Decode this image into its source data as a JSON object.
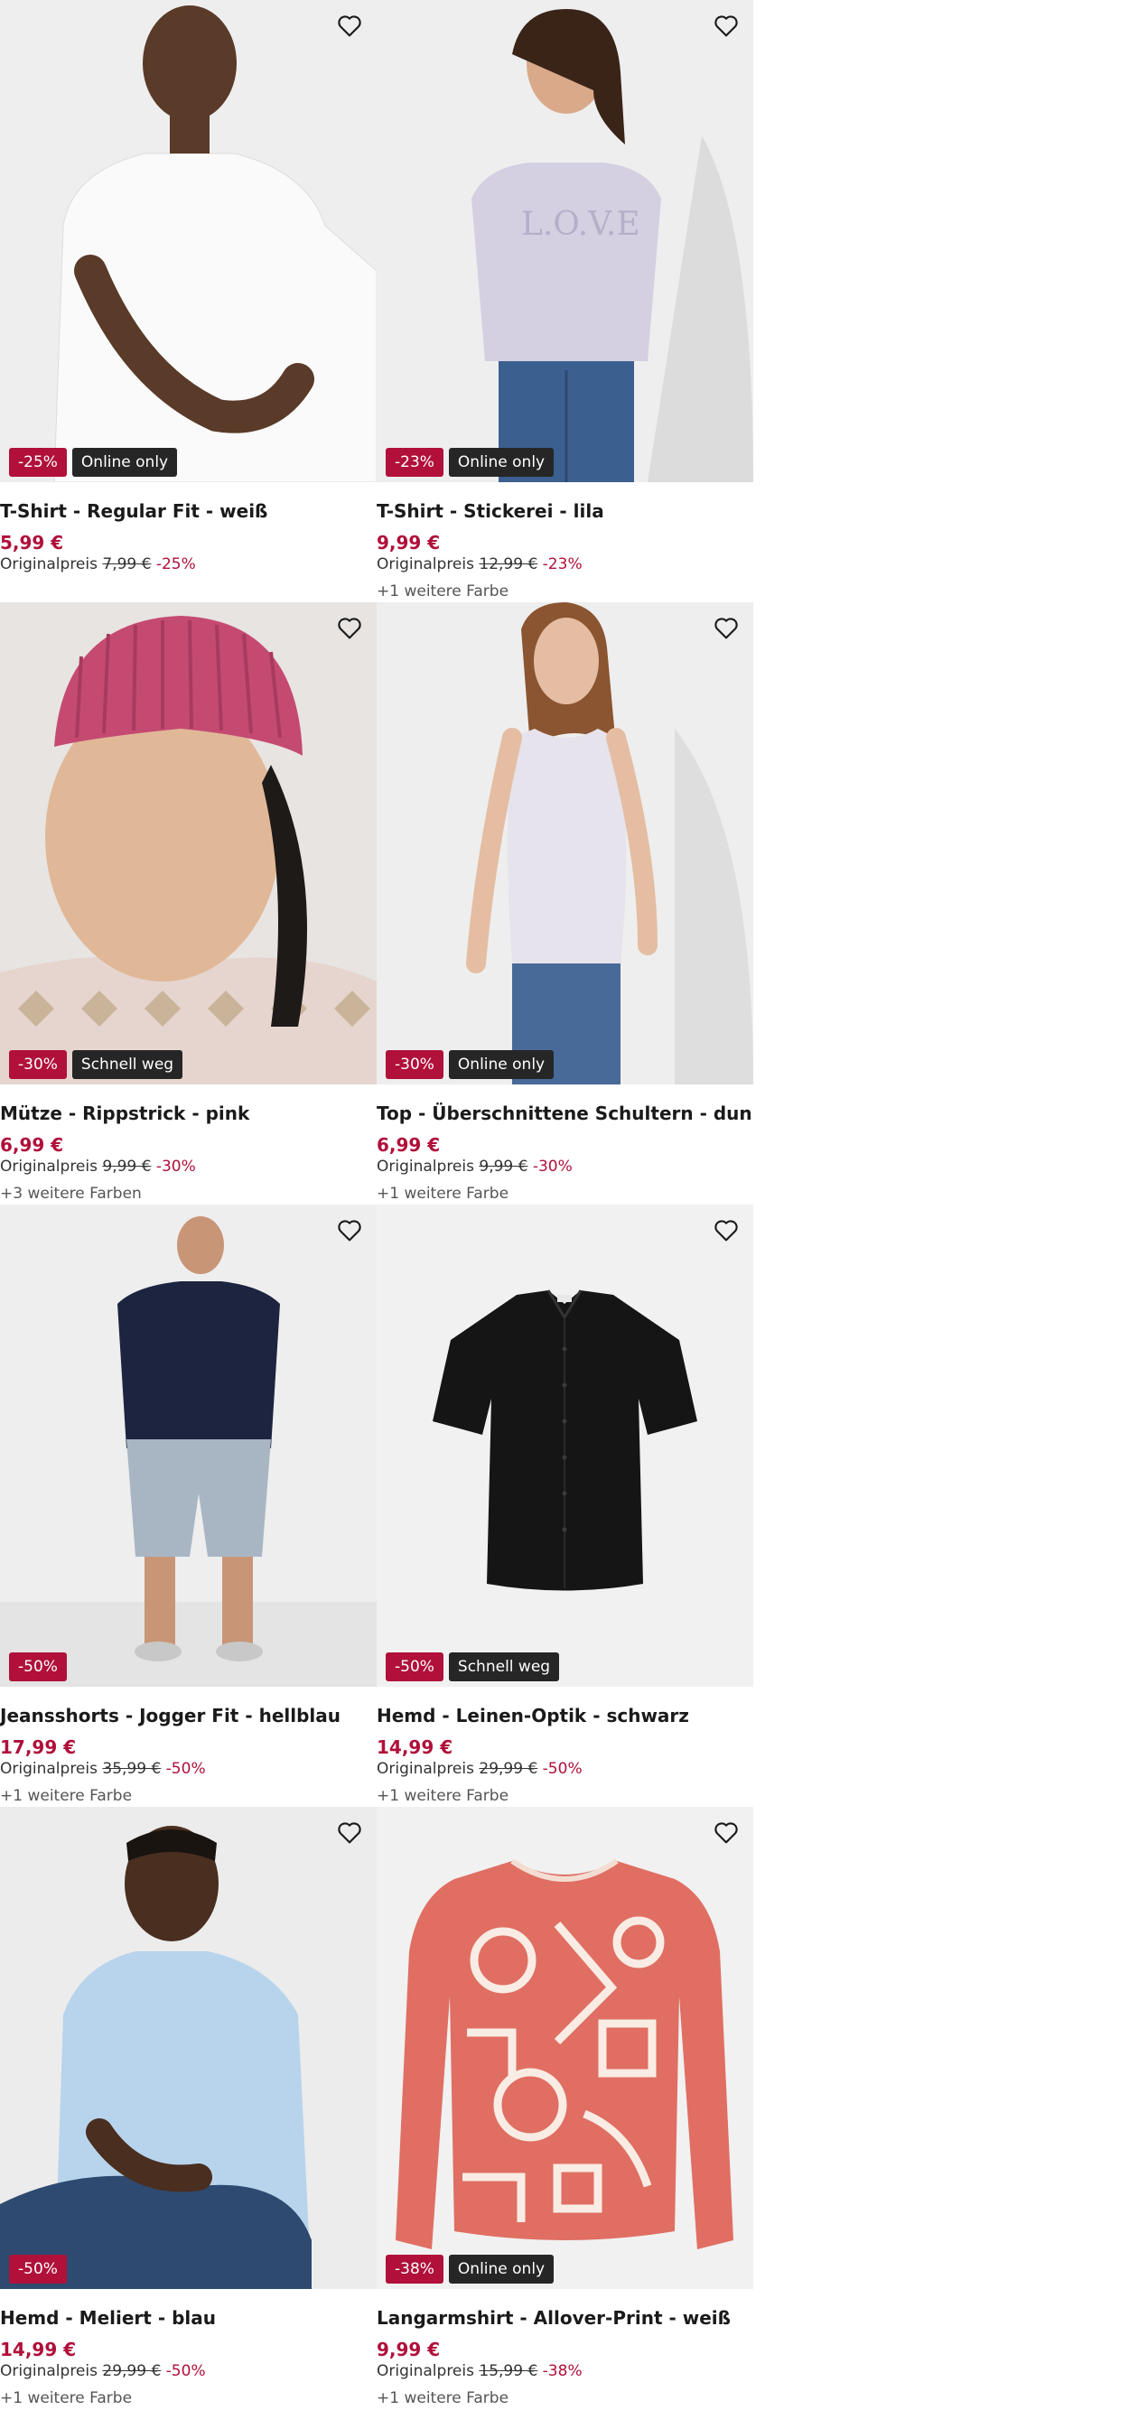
{
  "colors": {
    "sale": "#b0103a",
    "label_badge": "#262626",
    "image_background": "#eeeeee"
  },
  "icons": {
    "wishlist": "heart-outline-icon"
  },
  "products": [
    {
      "discount_badge": "-25%",
      "label_badge": "Online only",
      "title": "T-Shirt - Regular Fit - weiß",
      "price": "5,99 €",
      "original_label": "Originalpreis",
      "original_price": "7,99 €",
      "discount": "-25%",
      "more_colors": ""
    },
    {
      "discount_badge": "-23%",
      "label_badge": "Online only",
      "title": "T-Shirt - Stickerei - lila",
      "price": "9,99 €",
      "original_label": "Originalpreis",
      "original_price": "12,99 €",
      "discount": "-23%",
      "more_colors": "+1 weitere Farbe"
    },
    {
      "discount_badge": "-30%",
      "label_badge": "Schnell weg",
      "title": "Mütze - Rippstrick - pink",
      "price": "6,99 €",
      "original_label": "Originalpreis",
      "original_price": "9,99 €",
      "discount": "-30%",
      "more_colors": "+3 weitere Farben"
    },
    {
      "discount_badge": "-30%",
      "label_badge": "Online only",
      "title": "Top - Überschnittene Schultern - dunkellila",
      "price": "6,99 €",
      "original_label": "Originalpreis",
      "original_price": "9,99 €",
      "discount": "-30%",
      "more_colors": "+1 weitere Farbe"
    },
    {
      "discount_badge": "-50%",
      "label_badge": "",
      "title": "Jeansshorts - Jogger Fit - hellblau",
      "price": "17,99 €",
      "original_label": "Originalpreis",
      "original_price": "35,99 €",
      "discount": "-50%",
      "more_colors": "+1 weitere Farbe"
    },
    {
      "discount_badge": "-50%",
      "label_badge": "Schnell weg",
      "title": "Hemd - Leinen-Optik - schwarz",
      "price": "14,99 €",
      "original_label": "Originalpreis",
      "original_price": "29,99 €",
      "discount": "-50%",
      "more_colors": "+1 weitere Farbe"
    },
    {
      "discount_badge": "-50%",
      "label_badge": "",
      "title": "Hemd - Meliert - blau",
      "price": "14,99 €",
      "original_label": "Originalpreis",
      "original_price": "29,99 €",
      "discount": "-50%",
      "more_colors": "+1 weitere Farbe"
    },
    {
      "discount_badge": "-38%",
      "label_badge": "Online only",
      "title": "Langarmshirt - Allover-Print - weiß",
      "price": "9,99 €",
      "original_label": "Originalpreis",
      "original_price": "15,99 €",
      "discount": "-38%",
      "more_colors": "+1 weitere Farbe"
    }
  ]
}
